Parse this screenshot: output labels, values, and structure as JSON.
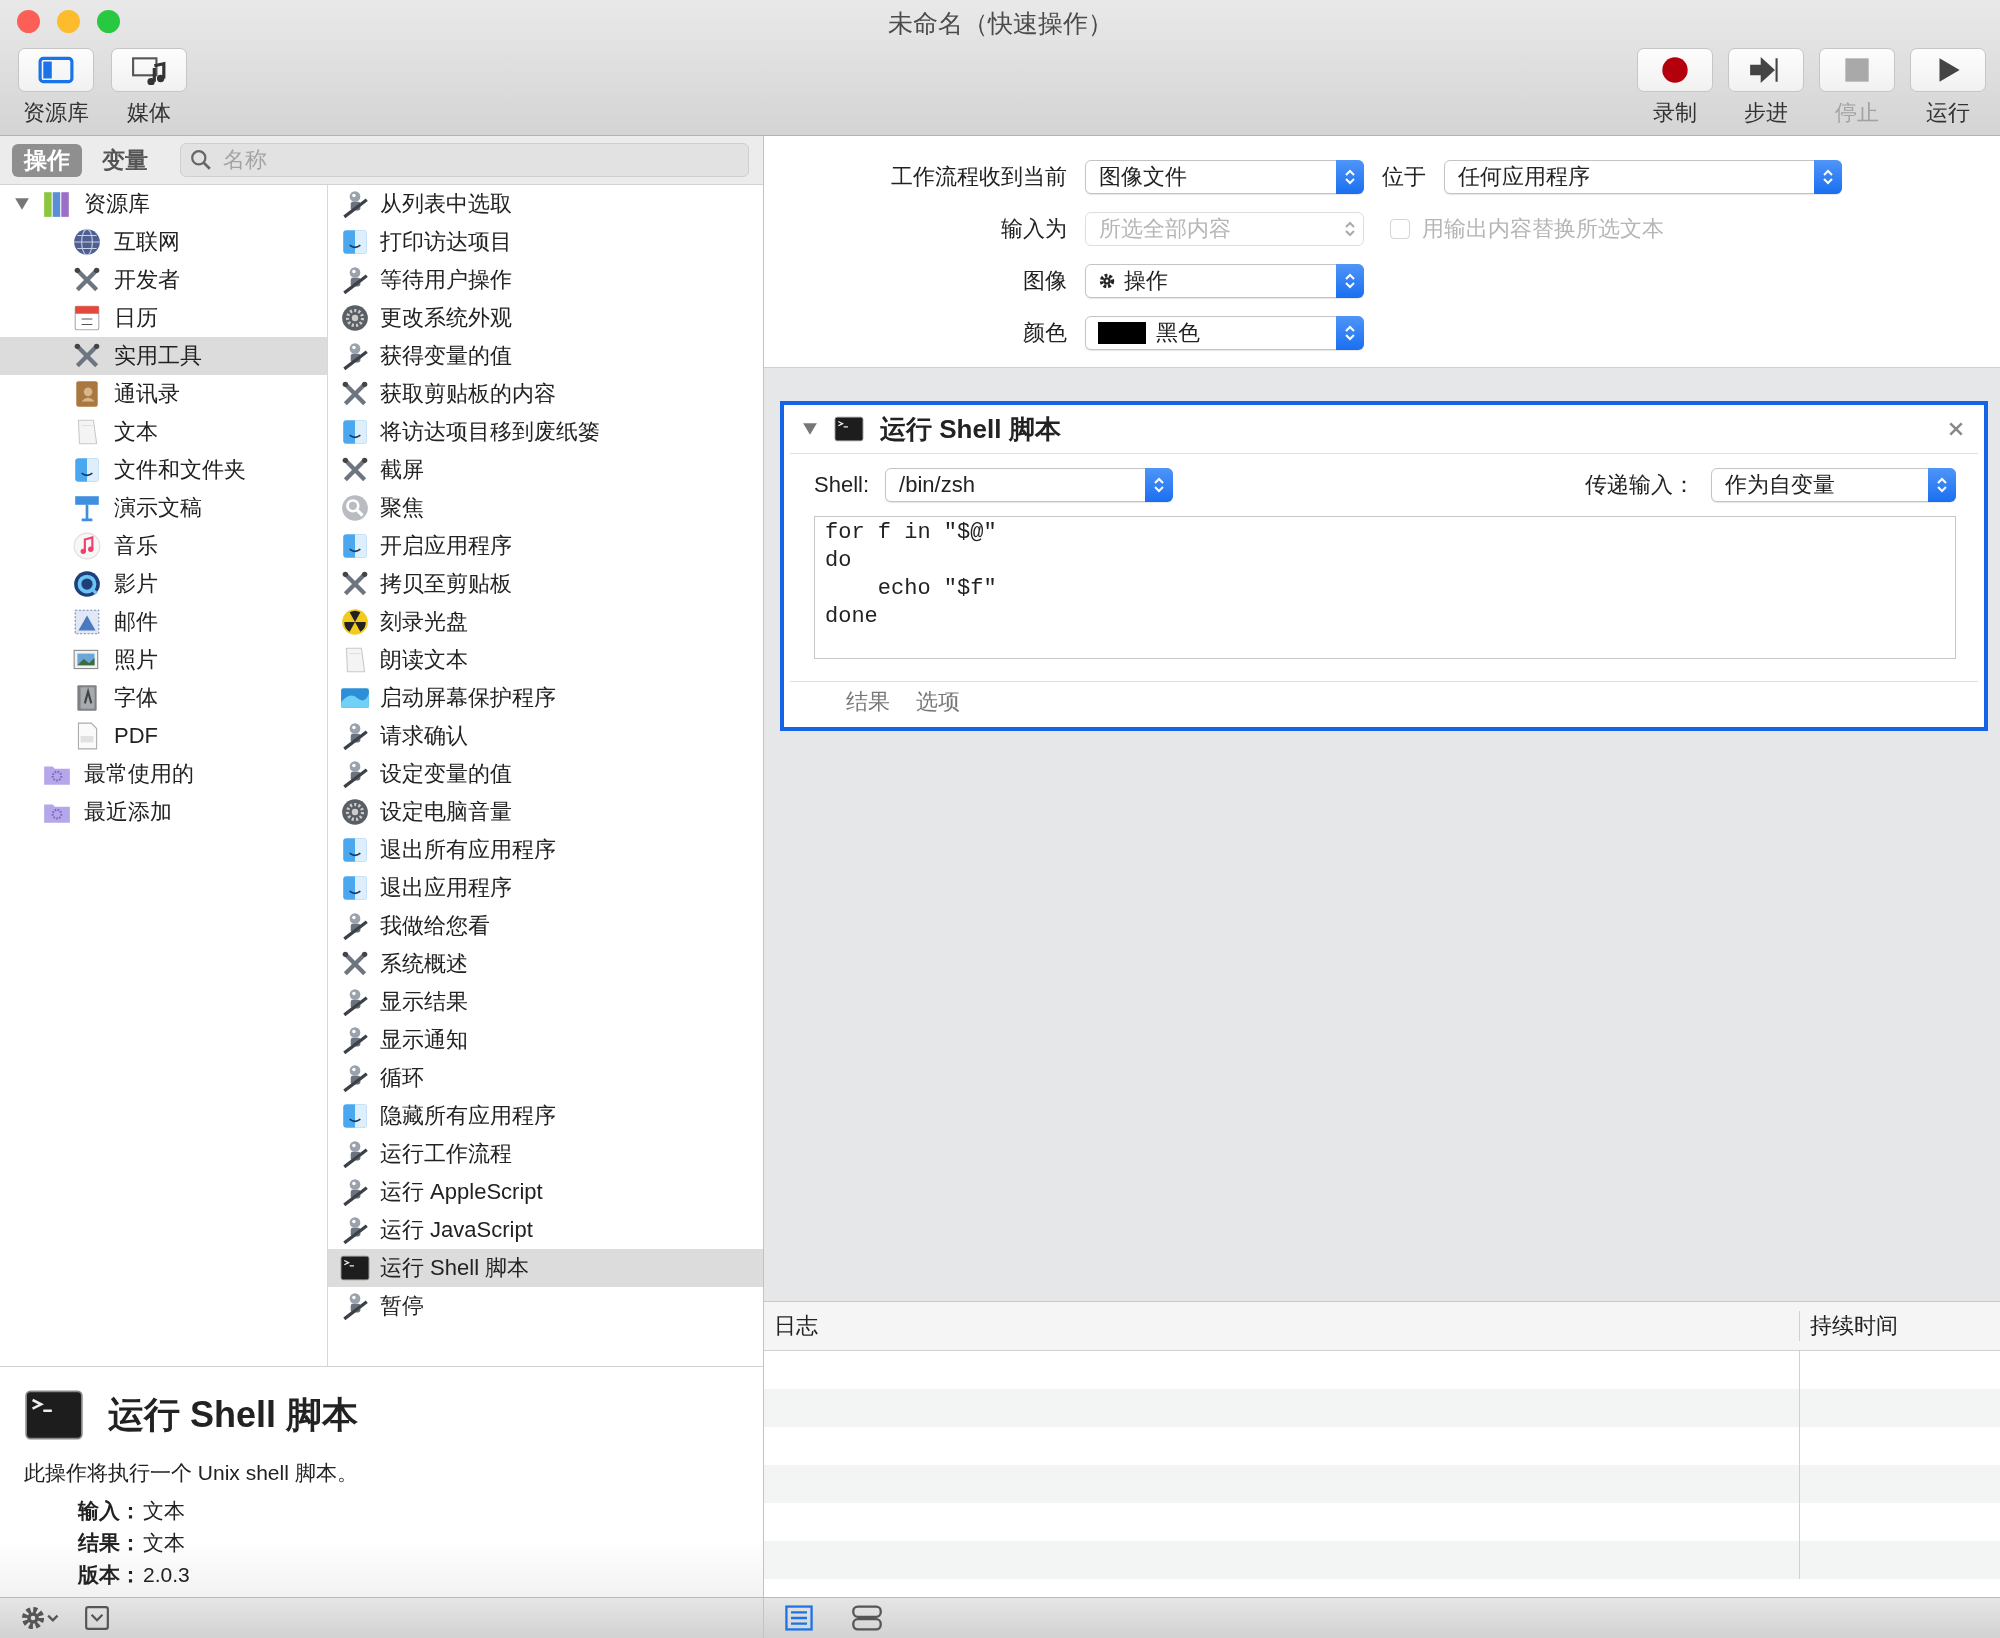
{
  "window": {
    "title": "未命名（快速操作）"
  },
  "toolbar": {
    "left": [
      {
        "label": "资源库",
        "kind": "library",
        "selected": true
      },
      {
        "label": "媒体",
        "kind": "media",
        "selected": false
      }
    ],
    "right": [
      {
        "label": "录制",
        "kind": "record",
        "disabled": false
      },
      {
        "label": "步进",
        "kind": "step",
        "disabled": false
      },
      {
        "label": "停止",
        "kind": "stop",
        "disabled": true
      },
      {
        "label": "运行",
        "kind": "run",
        "disabled": false
      }
    ]
  },
  "library_tabs": [
    {
      "label": "操作",
      "selected": true
    },
    {
      "label": "变量",
      "selected": false
    }
  ],
  "search": {
    "placeholder": "名称"
  },
  "library_tree": [
    {
      "label": "资源库",
      "kind": "books",
      "expanded": true,
      "selected": false,
      "children": [
        {
          "label": "互联网",
          "kind": "globe",
          "selected": false
        },
        {
          "label": "开发者",
          "kind": "tools",
          "selected": false
        },
        {
          "label": "日历",
          "kind": "calendar",
          "selected": false
        },
        {
          "label": "实用工具",
          "kind": "tools",
          "selected": true
        },
        {
          "label": "通讯录",
          "kind": "contacts",
          "selected": false
        },
        {
          "label": "文本",
          "kind": "paper",
          "selected": false
        },
        {
          "label": "文件和文件夹",
          "kind": "finder",
          "selected": false
        },
        {
          "label": "演示文稿",
          "kind": "podium",
          "selected": false
        },
        {
          "label": "音乐",
          "kind": "music",
          "selected": false
        },
        {
          "label": "影片",
          "kind": "quicktime",
          "selected": false
        },
        {
          "label": "邮件",
          "kind": "stamp",
          "selected": false
        },
        {
          "label": "照片",
          "kind": "photos",
          "selected": false
        },
        {
          "label": "字体",
          "kind": "fontbook",
          "selected": false
        },
        {
          "label": "PDF",
          "kind": "document",
          "selected": false
        }
      ]
    },
    {
      "label": "最常使用的",
      "kind": "smartfolder",
      "selected": false
    },
    {
      "label": "最近添加",
      "kind": "smartfolder",
      "selected": false
    }
  ],
  "actions": [
    {
      "label": "从列表中选取",
      "kind": "robot",
      "selected": false
    },
    {
      "label": "打印访达项目",
      "kind": "finder",
      "selected": false
    },
    {
      "label": "等待用户操作",
      "kind": "robot",
      "selected": false
    },
    {
      "label": "更改系统外观",
      "kind": "sysprefs",
      "selected": false
    },
    {
      "label": "获得变量的值",
      "kind": "robot",
      "selected": false
    },
    {
      "label": "获取剪贴板的内容",
      "kind": "tools",
      "selected": false
    },
    {
      "label": "将访达项目移到废纸篓",
      "kind": "finder",
      "selected": false
    },
    {
      "label": "截屏",
      "kind": "tools",
      "selected": false
    },
    {
      "label": "聚焦",
      "kind": "spotlight",
      "selected": false
    },
    {
      "label": "开启应用程序",
      "kind": "finder",
      "selected": false
    },
    {
      "label": "拷贝至剪贴板",
      "kind": "tools",
      "selected": false
    },
    {
      "label": "刻录光盘",
      "kind": "burn",
      "selected": false
    },
    {
      "label": "朗读文本",
      "kind": "paper",
      "selected": false
    },
    {
      "label": "启动屏幕保护程序",
      "kind": "screensaver",
      "selected": false
    },
    {
      "label": "请求确认",
      "kind": "robot",
      "selected": false
    },
    {
      "label": "设定变量的值",
      "kind": "robot",
      "selected": false
    },
    {
      "label": "设定电脑音量",
      "kind": "sysprefs",
      "selected": false
    },
    {
      "label": "退出所有应用程序",
      "kind": "finder",
      "selected": false
    },
    {
      "label": "退出应用程序",
      "kind": "finder",
      "selected": false
    },
    {
      "label": "我做给您看",
      "kind": "robot",
      "selected": false
    },
    {
      "label": "系统概述",
      "kind": "tools",
      "selected": false
    },
    {
      "label": "显示结果",
      "kind": "robot",
      "selected": false
    },
    {
      "label": "显示通知",
      "kind": "robot",
      "selected": false
    },
    {
      "label": "循环",
      "kind": "robot",
      "selected": false
    },
    {
      "label": "隐藏所有应用程序",
      "kind": "finder",
      "selected": false
    },
    {
      "label": "运行工作流程",
      "kind": "robot",
      "selected": false
    },
    {
      "label": "运行 AppleScript",
      "kind": "robot",
      "selected": false
    },
    {
      "label": "运行 JavaScript",
      "kind": "robot",
      "selected": false
    },
    {
      "label": "运行 Shell 脚本",
      "kind": "terminal",
      "selected": true
    },
    {
      "label": "暂停",
      "kind": "robot",
      "selected": false
    }
  ],
  "description": {
    "title": "运行 Shell 脚本",
    "text": "此操作将执行一个 Unix shell 脚本。",
    "fields": [
      {
        "label": "输入：",
        "value": "文本"
      },
      {
        "label": "结果：",
        "value": "文本"
      },
      {
        "label": "版本：",
        "value": "2.0.3"
      }
    ]
  },
  "workflow_settings": {
    "receives_label": "工作流程收到当前",
    "receives": "图像文件",
    "in_label": "位于",
    "in": "任何应用程序",
    "input_label": "输入为",
    "input": "所选全部内容",
    "input_disabled": true,
    "replace": {
      "label": "用输出内容替换所选文本",
      "checked": false,
      "disabled": true
    },
    "image_label": "图像",
    "image": "操作",
    "color_label": "颜色",
    "color_value": "黑色",
    "color": "#000000"
  },
  "action_card": {
    "title": "运行 Shell 脚本",
    "expanded": true,
    "shell_label": "Shell:",
    "shell": "/bin/zsh",
    "pass_label": "传递输入：",
    "pass": "作为自变量",
    "script": [
      "for f in \"$@\"",
      "do",
      "    echo \"$f\"",
      "done"
    ],
    "tabs": [
      {
        "label": "结果",
        "selected": false
      },
      {
        "label": "选项",
        "selected": false
      }
    ]
  },
  "log": {
    "columns": [
      "日志",
      "持续时间"
    ]
  },
  "view_buttons": [
    {
      "kind": "list",
      "selected": true
    },
    {
      "kind": "rows",
      "selected": false
    }
  ]
}
